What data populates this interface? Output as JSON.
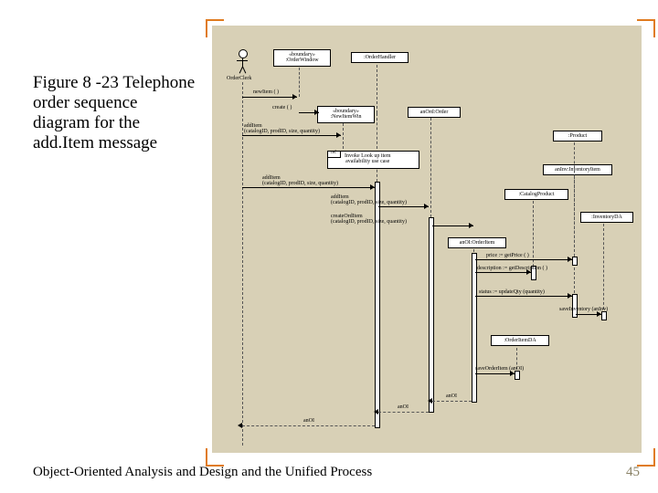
{
  "caption": "Figure 8 -23 Telephone order sequence diagram for the add.Item message",
  "footer": "Object-Oriented Analysis and Design and the Unified Process",
  "page_number": "45",
  "actor": "OrderClerk",
  "objects": {
    "orderWindow": "«boundary»\n:OrderWindow",
    "orderHandler": ":OrderHandler",
    "newItemWin": "«boundary»\n:NewItemWin",
    "anOrdOrder": "anOrd:Order",
    "product": ":Product",
    "anInvInventoryItem": "anInv:InventoryItem",
    "catalogProduct": ":CatalogProduct",
    "inventoryDA": ":InventoryDA",
    "anOIOrderItem": "anOI:OrderItem",
    "orderItemDA": ":OrderItemDA"
  },
  "messages": {
    "newItem": "newItem ( )",
    "create": "create ( )",
    "addItem1": "addItem\n(catalogID, prodID, size, quantity)",
    "invoke": "Invoke Look up item\navailability use case",
    "addItem2": "addItem\n(catalogID, prodID, size, quantity)",
    "addItem3": "addItem\n(catalogID, prodID, size, quantity)",
    "createOrdItem": "createOrdItem\n(catalogID, prodID, size, quantity)",
    "priceGetPrice": "price := getPrice ( )",
    "descGetDesc": "description := getDescription ( )",
    "statusUpdateQty": "status := updateQty (quantity)",
    "saveInventory": "saveInventory (anInv)",
    "saveOrderItem": "saveOrderItem (anOI)",
    "retAnOI1": "anOI",
    "retAnOI2": "anOI",
    "retAnOI3": "anOI"
  }
}
